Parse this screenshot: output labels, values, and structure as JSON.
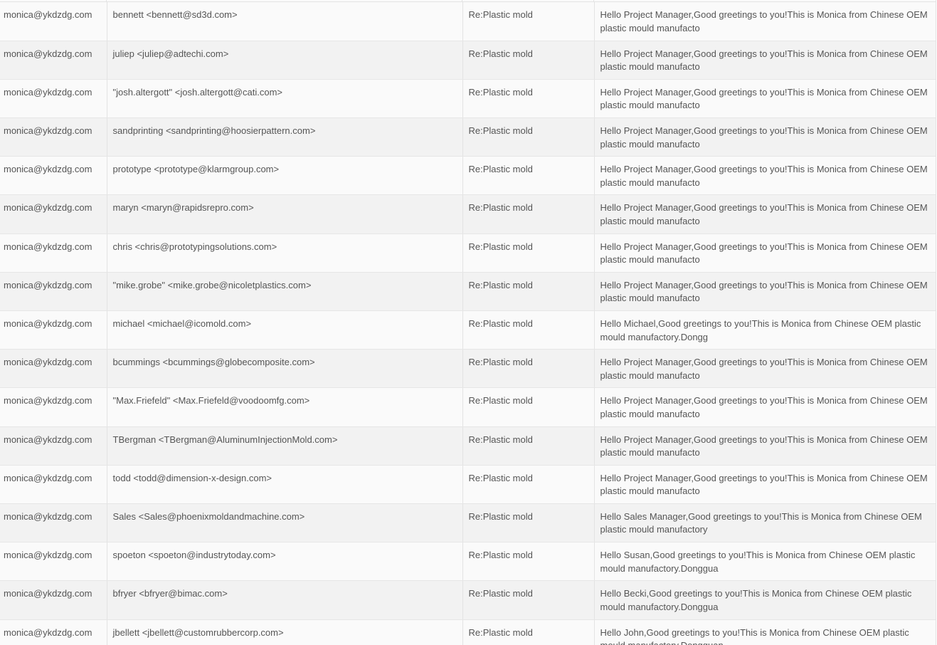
{
  "table": {
    "rows": [
      {
        "from": "monica@ykdzdg.com",
        "to": "bennett <bennett@sd3d.com>",
        "subject": "Re:Plastic mold",
        "body": "Hello Project Manager,Good greetings to you!This is Monica from Chinese OEM plastic mould manufacto"
      },
      {
        "from": "monica@ykdzdg.com",
        "to": "juliep <juliep@adtechi.com>",
        "subject": "Re:Plastic mold",
        "body": "Hello Project Manager,Good greetings to you!This is Monica from Chinese OEM plastic mould manufacto"
      },
      {
        "from": "monica@ykdzdg.com",
        "to": "\"josh.altergott\" <josh.altergott@cati.com>",
        "subject": "Re:Plastic mold",
        "body": "Hello Project Manager,Good greetings to you!This is Monica from Chinese OEM plastic mould manufacto"
      },
      {
        "from": "monica@ykdzdg.com",
        "to": "sandprinting <sandprinting@hoosierpattern.com>",
        "subject": "Re:Plastic mold",
        "body": "Hello Project Manager,Good greetings to you!This is Monica from Chinese OEM plastic mould manufacto"
      },
      {
        "from": "monica@ykdzdg.com",
        "to": "prototype <prototype@klarmgroup.com>",
        "subject": "Re:Plastic mold",
        "body": "Hello Project Manager,Good greetings to you!This is Monica from Chinese OEM plastic mould manufacto"
      },
      {
        "from": "monica@ykdzdg.com",
        "to": "maryn <maryn@rapidsrepro.com>",
        "subject": "Re:Plastic mold",
        "body": "Hello Project Manager,Good greetings to you!This is Monica from Chinese OEM plastic mould manufacto"
      },
      {
        "from": "monica@ykdzdg.com",
        "to": "chris <chris@prototypingsolutions.com>",
        "subject": "Re:Plastic mold",
        "body": "Hello Project Manager,Good greetings to you!This is Monica from Chinese OEM plastic mould manufacto"
      },
      {
        "from": "monica@ykdzdg.com",
        "to": "\"mike.grobe\" <mike.grobe@nicoletplastics.com>",
        "subject": "Re:Plastic mold",
        "body": "Hello Project Manager,Good greetings to you!This is Monica from Chinese OEM plastic mould manufacto"
      },
      {
        "from": "monica@ykdzdg.com",
        "to": "michael <michael@icomold.com>",
        "subject": "Re:Plastic mold",
        "body": "Hello Michael,Good greetings to you!This is Monica from Chinese OEM plastic mould manufactory.Dongg"
      },
      {
        "from": "monica@ykdzdg.com",
        "to": "bcummings <bcummings@globecomposite.com>",
        "subject": "Re:Plastic mold",
        "body": "Hello Project Manager,Good greetings to you!This is Monica from Chinese OEM plastic mould manufacto"
      },
      {
        "from": "monica@ykdzdg.com",
        "to": "\"Max.Friefeld\" <Max.Friefeld@voodoomfg.com>",
        "subject": "Re:Plastic mold",
        "body": "Hello Project Manager,Good greetings to you!This is Monica from Chinese OEM plastic mould manufacto"
      },
      {
        "from": "monica@ykdzdg.com",
        "to": "TBergman <TBergman@AluminumInjectionMold.com>",
        "subject": "Re:Plastic mold",
        "body": "Hello Project Manager,Good greetings to you!This is Monica from Chinese OEM plastic mould manufacto"
      },
      {
        "from": "monica@ykdzdg.com",
        "to": "todd <todd@dimension-x-design.com>",
        "subject": "Re:Plastic mold",
        "body": "Hello Project Manager,Good greetings to you!This is Monica from Chinese OEM plastic mould manufacto"
      },
      {
        "from": "monica@ykdzdg.com",
        "to": "Sales <Sales@phoenixmoldandmachine.com>",
        "subject": "Re:Plastic mold",
        "body": "Hello Sales Manager,Good greetings to you!This is Monica from Chinese OEM plastic mould manufactory"
      },
      {
        "from": "monica@ykdzdg.com",
        "to": "spoeton <spoeton@industrytoday.com>",
        "subject": "Re:Plastic mold",
        "body": "Hello Susan,Good greetings to you!This is Monica from Chinese OEM plastic mould manufactory.Donggua"
      },
      {
        "from": "monica@ykdzdg.com",
        "to": "bfryer <bfryer@bimac.com>",
        "subject": "Re:Plastic mold",
        "body": "Hello Becki,Good greetings to you!This is Monica from Chinese OEM plastic mould manufactory.Donggua"
      },
      {
        "from": "monica@ykdzdg.com",
        "to": "jbellett <jbellett@customrubbercorp.com>",
        "subject": "Re:Plastic mold",
        "body": "Hello John,Good greetings to you!This is Monica from Chinese OEM plastic mould manufactory.Dongguan"
      }
    ]
  }
}
